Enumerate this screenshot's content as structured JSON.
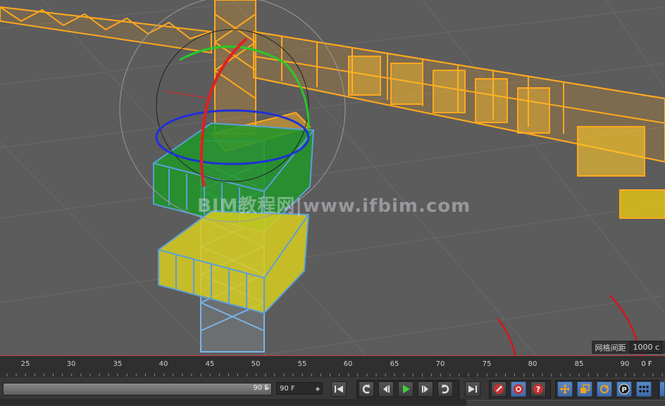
{
  "viewport": {
    "watermark": "BIM教程网|www.ifbim.com",
    "grid_spacing_label": "网格间距",
    "grid_spacing_value": "1000 c"
  },
  "timeline": {
    "ticks": [
      "25",
      "30",
      "35",
      "40",
      "45",
      "50",
      "55",
      "60",
      "65",
      "70",
      "75",
      "80",
      "85",
      "90"
    ],
    "end_label": "0 F"
  },
  "playback": {
    "slider_value": "90 F",
    "frame_field": "90 F"
  },
  "toolbar": {
    "buttons": [
      {
        "name": "goto-start-button",
        "icon": "skip-start-icon"
      },
      {
        "name": "prev-key-button",
        "icon": "prev-key-icon"
      },
      {
        "name": "prev-frame-button",
        "icon": "step-back-icon"
      },
      {
        "name": "play-button",
        "icon": "play-icon"
      },
      {
        "name": "next-frame-button",
        "icon": "step-forward-icon"
      },
      {
        "name": "next-key-button",
        "icon": "next-key-icon"
      },
      {
        "name": "goto-end-button",
        "icon": "skip-end-icon"
      },
      {
        "name": "record-button",
        "icon": "record-key-icon"
      },
      {
        "name": "autokey-button",
        "icon": "autokey-icon"
      },
      {
        "name": "key-help-button",
        "icon": "question-icon"
      },
      {
        "name": "move-key-button",
        "icon": "move-icon"
      },
      {
        "name": "scale-key-button",
        "icon": "scale-icon"
      },
      {
        "name": "rotate-key-button",
        "icon": "rotate-icon"
      },
      {
        "name": "param-key-button",
        "icon": "param-p-icon"
      },
      {
        "name": "point-level-button",
        "icon": "dots-icon"
      }
    ]
  },
  "colors": {
    "crane_orange": "#ffa81e",
    "cabin_green": "#22a030",
    "cabin_yellow": "#d8d020",
    "wire_blue": "#7ab4e8",
    "gizmo_red": "#e22020",
    "gizmo_green": "#28c828",
    "gizmo_blue": "#2030d8",
    "annotation_red": "#d01818",
    "timeline_red": "#c23b3b"
  }
}
